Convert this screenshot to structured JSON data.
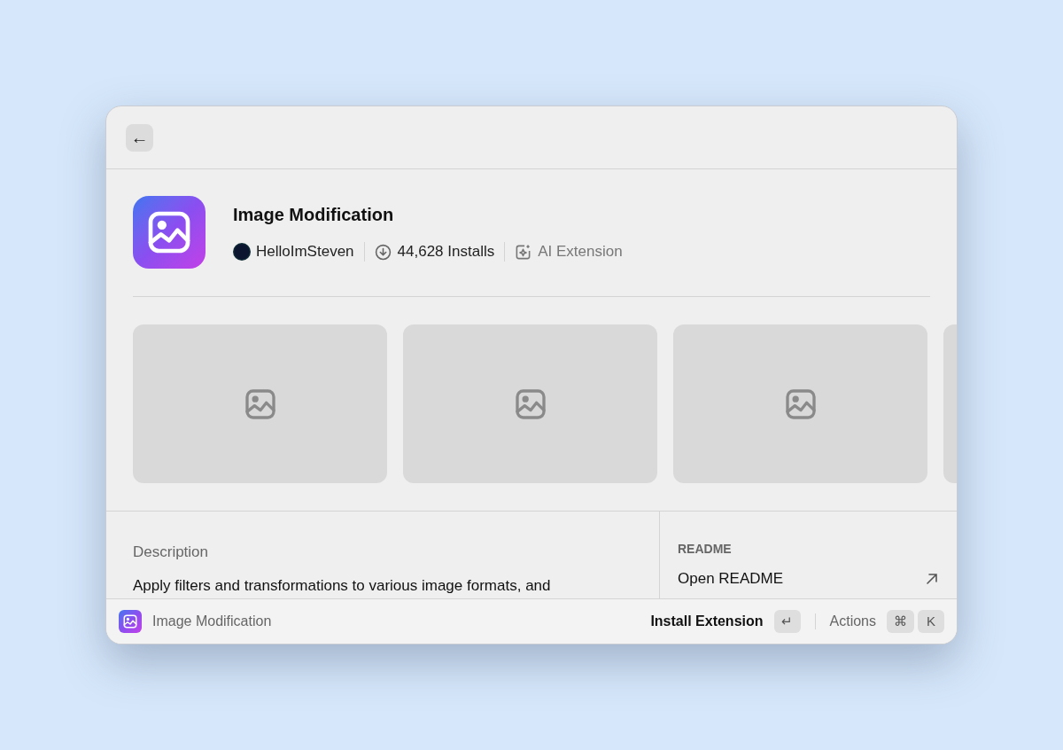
{
  "header": {
    "back_button": "←"
  },
  "extension": {
    "title": "Image Modification",
    "author": "HelloImSteven",
    "installs": "44,628 Installs",
    "badge": "AI Extension"
  },
  "screenshots": [
    {
      "kind": "placeholder"
    },
    {
      "kind": "placeholder"
    },
    {
      "kind": "placeholder"
    },
    {
      "kind": "placeholder_edge"
    }
  ],
  "description": {
    "heading": "Description",
    "text": "Apply filters and transformations to various image formats, and"
  },
  "readme": {
    "heading": "README",
    "link": "Open README"
  },
  "footer": {
    "title": "Image Modification",
    "primary_action": "Install Extension",
    "primary_keys": [
      "↵"
    ],
    "secondary_action": "Actions",
    "secondary_keys": [
      "⌘",
      "K"
    ]
  }
}
